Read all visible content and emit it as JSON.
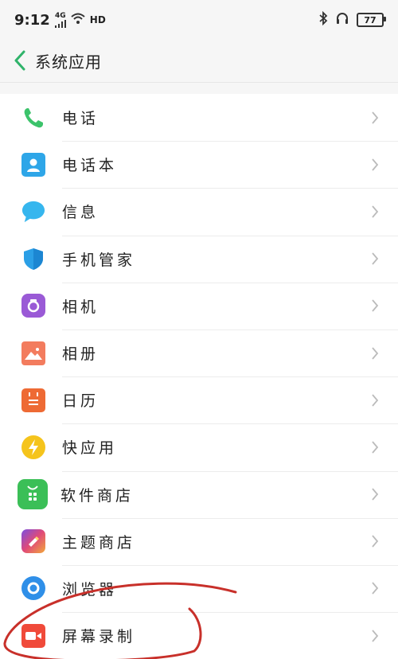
{
  "status_bar": {
    "time": "9:12",
    "network": "4G",
    "hd": "HD",
    "battery": "77"
  },
  "header": {
    "title": "系统应用"
  },
  "apps": [
    {
      "label": "电话",
      "icon": "phone-icon"
    },
    {
      "label": "电话本",
      "icon": "contacts-icon"
    },
    {
      "label": "信息",
      "icon": "messages-icon"
    },
    {
      "label": "手机管家",
      "icon": "phone-manager-icon"
    },
    {
      "label": "相机",
      "icon": "camera-icon"
    },
    {
      "label": "相册",
      "icon": "gallery-icon"
    },
    {
      "label": "日历",
      "icon": "calendar-icon"
    },
    {
      "label": "快应用",
      "icon": "quick-app-icon"
    },
    {
      "label": "软件商店",
      "icon": "app-store-icon"
    },
    {
      "label": "主题商店",
      "icon": "theme-store-icon"
    },
    {
      "label": "浏览器",
      "icon": "browser-icon"
    },
    {
      "label": "屏幕录制",
      "icon": "screen-recorder-icon"
    }
  ],
  "colors": {
    "accent": "#2fb36a",
    "annotation": "#c8302a"
  }
}
